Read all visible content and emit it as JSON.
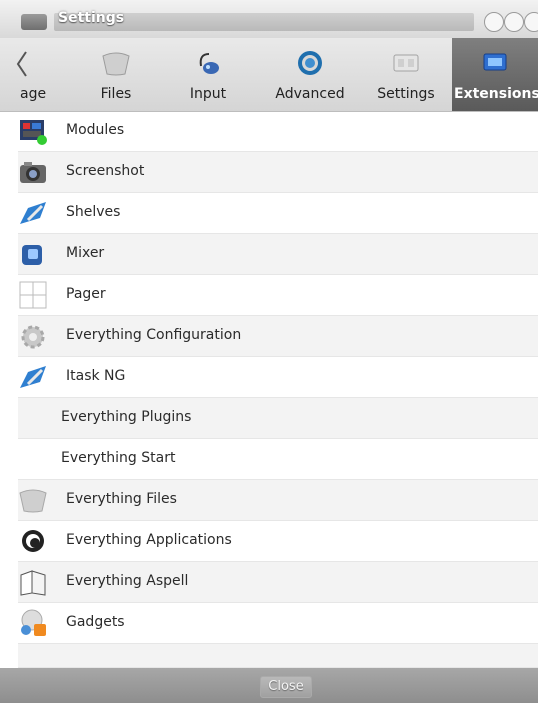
{
  "window": {
    "title": "Settings"
  },
  "tabs": [
    {
      "label": "age",
      "icon": "chevron-left-icon"
    },
    {
      "label": "Files",
      "icon": "files-icon"
    },
    {
      "label": "Input",
      "icon": "input-icon"
    },
    {
      "label": "Advanced",
      "icon": "advanced-gear-icon"
    },
    {
      "label": "Settings",
      "icon": "settings-panel-icon"
    },
    {
      "label": "Extensions",
      "icon": "extensions-icon",
      "active": true
    }
  ],
  "items": [
    {
      "label": "Modules",
      "icon": "modules-icon"
    },
    {
      "label": "Screenshot",
      "icon": "camera-icon"
    },
    {
      "label": "Shelves",
      "icon": "shelves-tools-icon"
    },
    {
      "label": "Mixer",
      "icon": "mixer-icon"
    },
    {
      "label": "Pager",
      "icon": "pager-grid-icon"
    },
    {
      "label": "Everything Configuration",
      "icon": "gear-icon"
    },
    {
      "label": "Itask NG",
      "icon": "itask-tools-icon"
    },
    {
      "label": "Everything Plugins",
      "icon": ""
    },
    {
      "label": "Everything Start",
      "icon": ""
    },
    {
      "label": "Everything Files",
      "icon": "files-icon"
    },
    {
      "label": "Everything Applications",
      "icon": "applications-icon"
    },
    {
      "label": "Everything Aspell",
      "icon": "book-icon"
    },
    {
      "label": "Gadgets",
      "icon": "gadgets-icon"
    }
  ],
  "footer": {
    "close_label": "Close"
  }
}
